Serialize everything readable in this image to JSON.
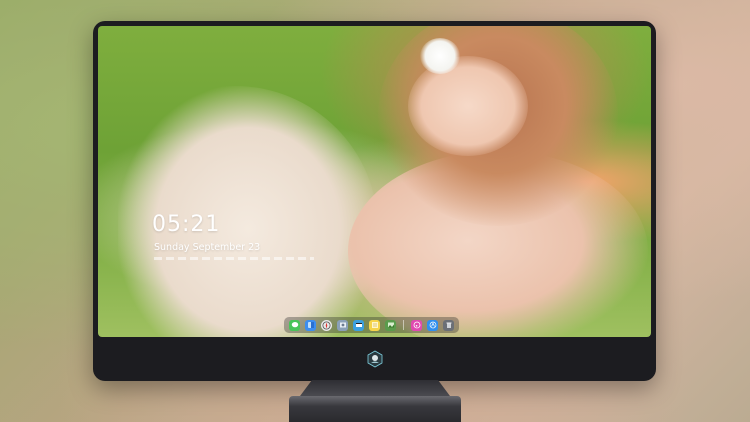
{
  "lockscreen": {
    "time": "05:21",
    "date": "Sunday September  23"
  },
  "dock": {
    "icons": [
      {
        "name": "messages-icon",
        "color": "#49c45a"
      },
      {
        "name": "finder-icon",
        "color": "#3d8ef0"
      },
      {
        "name": "safari-icon",
        "color": "#e9e9e9"
      },
      {
        "name": "preview-icon",
        "color": "#8aa0b8"
      },
      {
        "name": "video-icon",
        "color": "#3aa0e0"
      },
      {
        "name": "notes-icon",
        "color": "#f6d44a"
      },
      {
        "name": "photos-icon",
        "color": "#5a9c4c"
      },
      {
        "name": "itunes-icon",
        "color": "#e04ab0"
      },
      {
        "name": "app-store-icon",
        "color": "#2f8ff0"
      },
      {
        "name": "trash-icon",
        "color": "#6b6f76"
      }
    ]
  },
  "colors": {
    "bezel": "#1c1c20",
    "text": "#ffffff"
  }
}
